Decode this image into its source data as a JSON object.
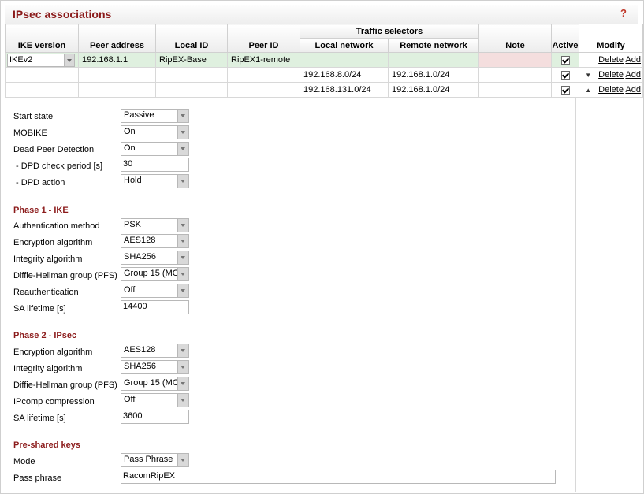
{
  "title": "IPsec associations",
  "help": "?",
  "table": {
    "headers": {
      "ike_version": "IKE version",
      "peer_address": "Peer address",
      "local_id": "Local ID",
      "peer_id": "Peer ID",
      "traffic_selectors": "Traffic selectors",
      "local_network": "Local network",
      "remote_network": "Remote network",
      "note": "Note",
      "active": "Active",
      "modify": "Modify"
    },
    "row1": {
      "ike_version": "IKEv2",
      "peer_address": "192.168.1.1",
      "local_id": "RipEX-Base",
      "peer_id": "RipEX1-remote",
      "note": ""
    },
    "selectors": [
      {
        "local_network": "192.168.8.0/24",
        "remote_network": "192.168.1.0/24"
      },
      {
        "local_network": "192.168.131.0/24",
        "remote_network": "192.168.1.0/24"
      }
    ],
    "delete_label": "Delete",
    "add_label": "Add"
  },
  "general": {
    "start_state": {
      "label": "Start state",
      "value": "Passive"
    },
    "mobike": {
      "label": "MOBIKE",
      "value": "On"
    },
    "dpd": {
      "label": "Dead Peer Detection",
      "value": "On"
    },
    "dpd_period": {
      "label": " - DPD check period [s]",
      "value": "30"
    },
    "dpd_action": {
      "label": " - DPD action",
      "value": "Hold"
    }
  },
  "phase1": {
    "title": "Phase 1 - IKE",
    "auth": {
      "label": "Authentication method",
      "value": "PSK"
    },
    "enc": {
      "label": "Encryption algorithm",
      "value": "AES128"
    },
    "integ": {
      "label": "Integrity algorithm",
      "value": "SHA256"
    },
    "dh": {
      "label": "Diffie-Hellman group (PFS)",
      "value": "Group 15 (MO"
    },
    "reauth": {
      "label": "Reauthentication",
      "value": "Off"
    },
    "lifetime": {
      "label": "SA lifetime [s]",
      "value": "14400"
    }
  },
  "phase2": {
    "title": "Phase 2 - IPsec",
    "enc": {
      "label": "Encryption algorithm",
      "value": "AES128"
    },
    "integ": {
      "label": "Integrity algorithm",
      "value": "SHA256"
    },
    "dh": {
      "label": "Diffie-Hellman group (PFS)",
      "value": "Group 15 (MO"
    },
    "ipcomp": {
      "label": "IPcomp compression",
      "value": "Off"
    },
    "lifetime": {
      "label": "SA lifetime [s]",
      "value": "3600"
    }
  },
  "psk": {
    "title": "Pre-shared keys",
    "mode": {
      "label": "Mode",
      "value": "Pass Phrase"
    },
    "phrase": {
      "label": "Pass phrase",
      "value": "RacomRipEX"
    }
  },
  "colors": {
    "accent": "#8b1a1a",
    "row_active": "#dff0df",
    "note_cell": "#f4dede"
  }
}
